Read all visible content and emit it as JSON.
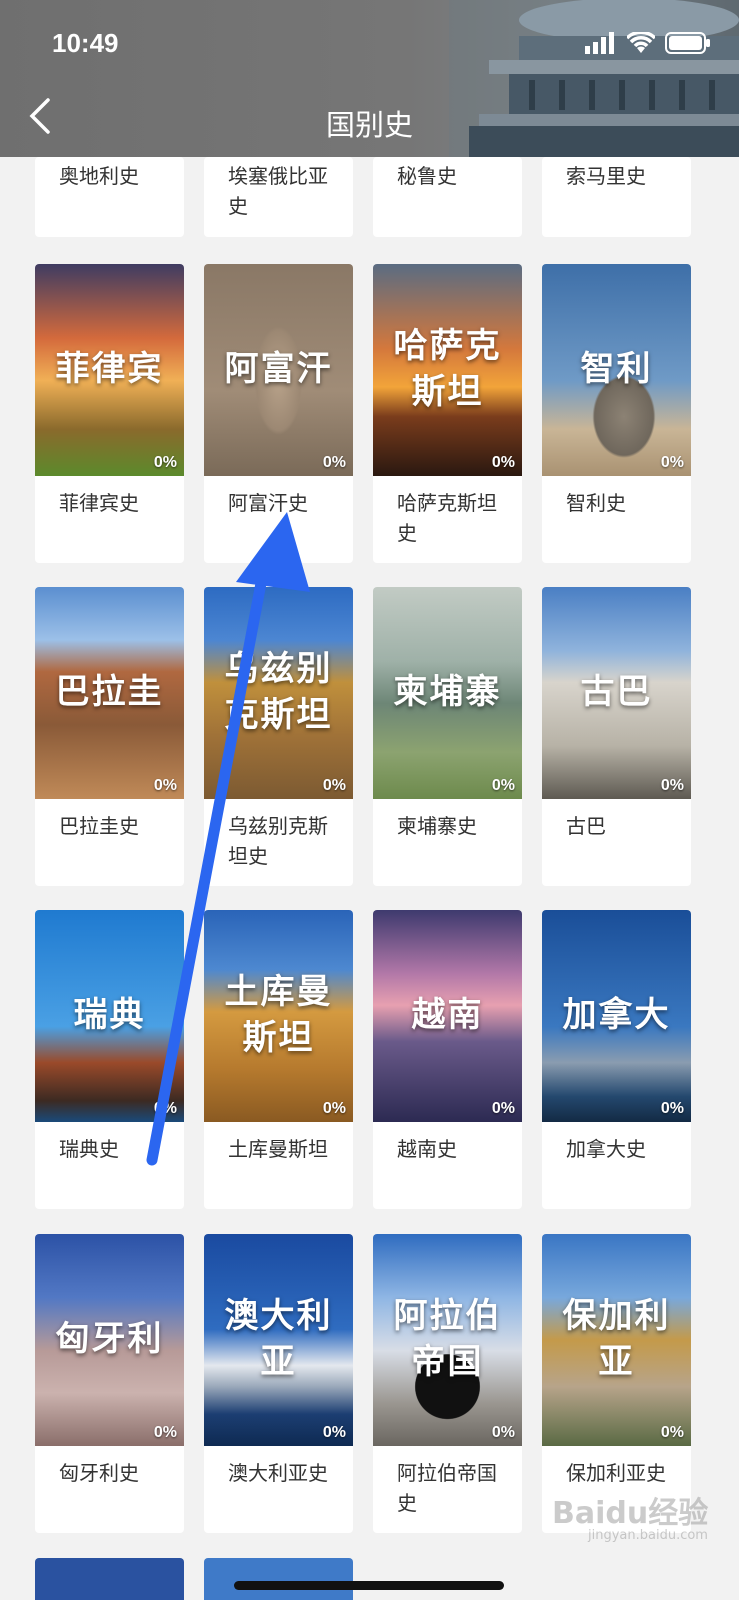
{
  "status": {
    "time": "10:49"
  },
  "header": {
    "title": "国别史"
  },
  "top_row": [
    {
      "label": "奥地利史"
    },
    {
      "label": "埃塞俄比亚史"
    },
    {
      "label": "秘鲁史"
    },
    {
      "label": "索马里史"
    }
  ],
  "cards": [
    {
      "cover_title": "菲律宾",
      "progress": "0%",
      "label": "菲律宾史"
    },
    {
      "cover_title": "阿富汗",
      "progress": "0%",
      "label": "阿富汗史"
    },
    {
      "cover_title": "哈萨克斯坦",
      "progress": "0%",
      "label": "哈萨克斯坦史"
    },
    {
      "cover_title": "智利",
      "progress": "0%",
      "label": "智利史"
    },
    {
      "cover_title": "巴拉圭",
      "progress": "0%",
      "label": "巴拉圭史"
    },
    {
      "cover_title": "乌兹别克斯坦",
      "progress": "0%",
      "label": "乌兹别克斯坦史"
    },
    {
      "cover_title": "柬埔寨",
      "progress": "0%",
      "label": "柬埔寨史"
    },
    {
      "cover_title": "古巴",
      "progress": "0%",
      "label": "古巴"
    },
    {
      "cover_title": "瑞典",
      "progress": "0%",
      "label": "瑞典史"
    },
    {
      "cover_title": "土库曼斯坦",
      "progress": "0%",
      "label": "土库曼斯坦"
    },
    {
      "cover_title": "越南",
      "progress": "0%",
      "label": "越南史"
    },
    {
      "cover_title": "加拿大",
      "progress": "0%",
      "label": "加拿大史"
    },
    {
      "cover_title": "匈牙利",
      "progress": "0%",
      "label": "匈牙利史"
    },
    {
      "cover_title": "澳大利亚",
      "progress": "0%",
      "label": "澳大利亚史"
    },
    {
      "cover_title": "阿拉伯帝国",
      "progress": "0%",
      "label": "阿拉伯帝国史"
    },
    {
      "cover_title": "保加利亚",
      "progress": "0%",
      "label": "保加利亚史"
    }
  ],
  "watermark": {
    "brand": "Baidu经验",
    "url": "jingyan.baidu.com"
  }
}
